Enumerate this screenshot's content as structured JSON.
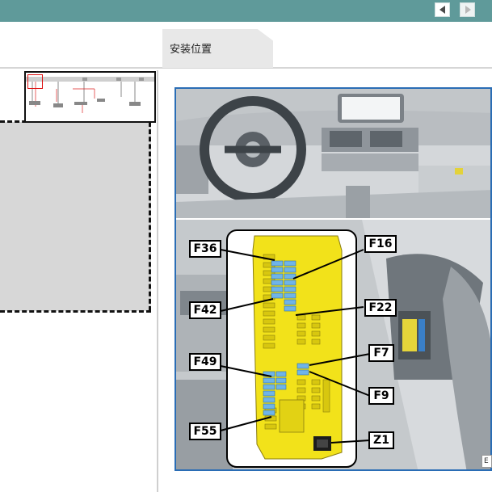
{
  "toolbar": {
    "prev_icon": "chevron-left-icon",
    "next_icon": "chevron-right-icon"
  },
  "tabs": [
    {
      "label": "安装位置",
      "active": true
    }
  ],
  "figure": {
    "callouts": [
      "F36",
      "F16",
      "F42",
      "F22",
      "F7",
      "F49",
      "F9",
      "F55",
      "Z1"
    ],
    "figure_code": "E"
  },
  "colors": {
    "topbar": "#5f9a9a",
    "frame_border": "#2a6db5",
    "fusebox": "#f2e21a",
    "fuse_highlight": "#6fb4e8"
  }
}
